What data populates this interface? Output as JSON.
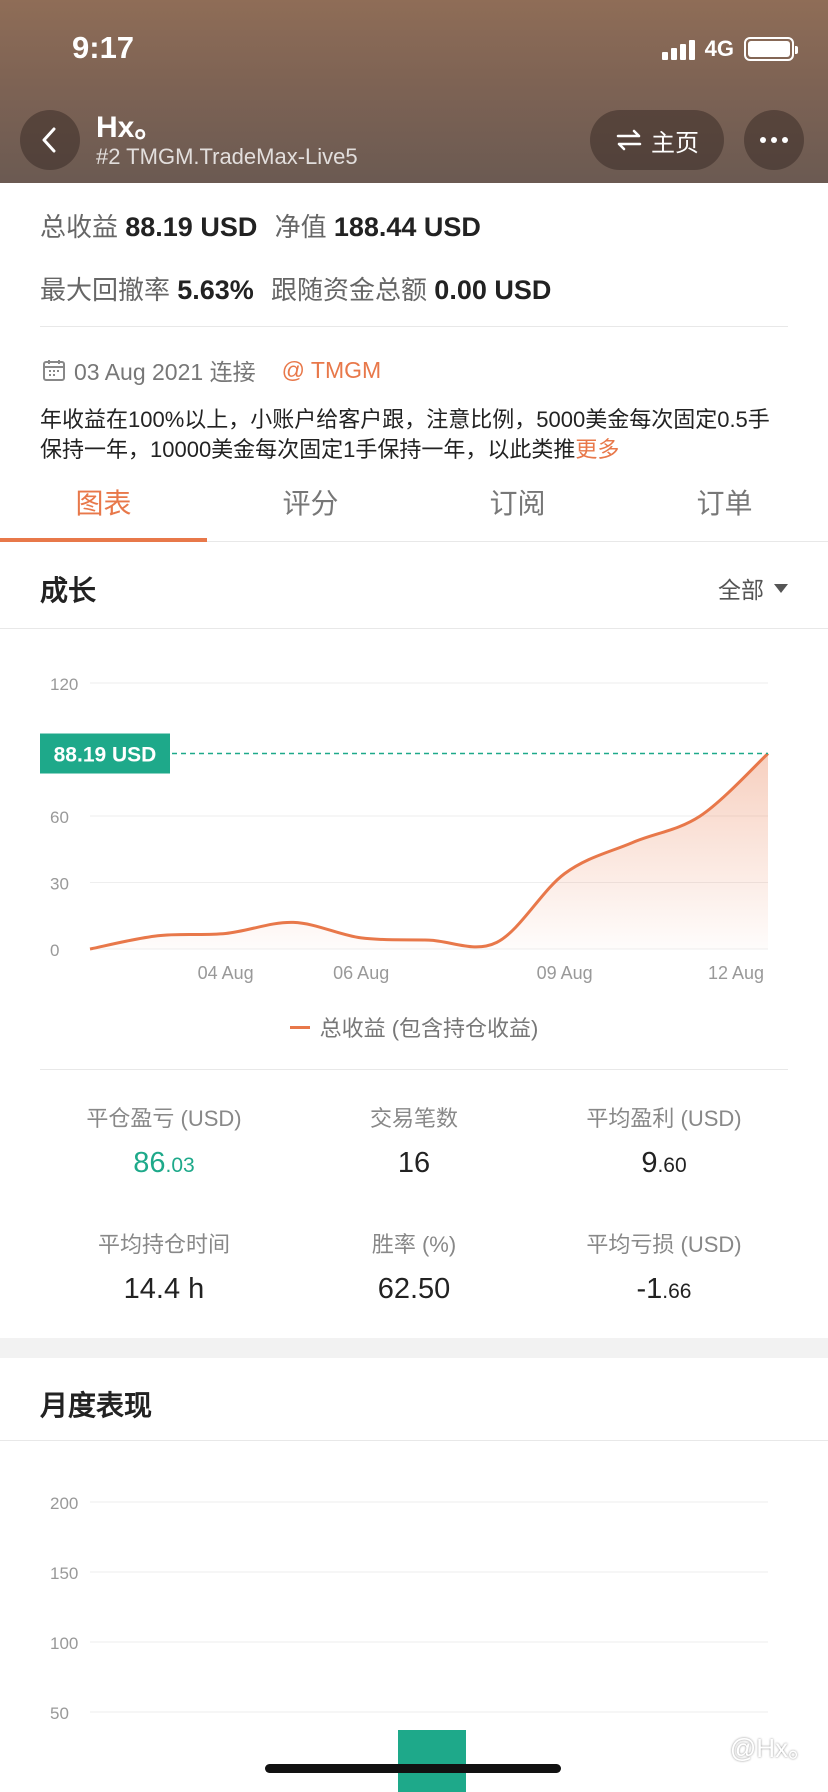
{
  "status_bar": {
    "time": "9:17",
    "network": "4G"
  },
  "header": {
    "title": "Hx。",
    "subtitle": "#2 TMGM.TradeMax-Live5",
    "home_label": "主页"
  },
  "summary": {
    "total_profit_label": "总收益",
    "total_profit_value": "88.19 USD",
    "equity_label": "净值",
    "equity_value": "188.44 USD",
    "max_drawdown_label": "最大回撤率",
    "max_drawdown_value": "5.63%",
    "follow_funds_label": "跟随资金总额",
    "follow_funds_value": "0.00 USD"
  },
  "connect": {
    "date": "03 Aug 2021 连接",
    "broker": "@ TMGM"
  },
  "description": {
    "text": "年收益在100%以上，小账户给客户跟，注意比例，5000美金每次固定0.5手保持一年，10000美金每次固定1手保持一年，以此类推",
    "more": "更多"
  },
  "tabs": [
    "图表",
    "评分",
    "订阅",
    "订单"
  ],
  "growth": {
    "title": "成长",
    "filter": "全部",
    "legend": "总收益 (包含持仓收益)",
    "current_badge": "88.19 USD"
  },
  "stats": [
    {
      "label": "平仓盈亏 (USD)",
      "value_int": "86",
      "value_dec": ".03",
      "color": "#1ea98a"
    },
    {
      "label": "交易笔数",
      "value_int": "16",
      "value_dec": ""
    },
    {
      "label": "平均盈利 (USD)",
      "value_int": "9",
      "value_dec": ".60"
    },
    {
      "label": "平均持仓时间",
      "value_int": "14.4 h",
      "value_dec": ""
    },
    {
      "label": "胜率 (%)",
      "value_int": "62.50",
      "value_dec": ""
    },
    {
      "label": "平均亏损 (USD)",
      "value_int": "-1",
      "value_dec": ".66"
    }
  ],
  "monthly": {
    "title": "月度表现"
  },
  "watermark": "@Hx。",
  "colors": {
    "accent": "#e8784a",
    "green": "#1ea98a"
  },
  "chart_data": [
    {
      "type": "area",
      "title": "",
      "x_ticks": [
        "04 Aug",
        "06 Aug",
        "09 Aug",
        "12 Aug"
      ],
      "y_ticks": [
        0,
        30,
        60,
        120
      ],
      "ylim": [
        0,
        120
      ],
      "series": [
        {
          "name": "总收益 (包含持仓收益)",
          "points": [
            {
              "x": "02 Aug",
              "y": 0
            },
            {
              "x": "03 Aug",
              "y": 6
            },
            {
              "x": "04 Aug",
              "y": 7
            },
            {
              "x": "05 Aug",
              "y": 12
            },
            {
              "x": "06 Aug",
              "y": 5
            },
            {
              "x": "07 Aug",
              "y": 4
            },
            {
              "x": "08 Aug",
              "y": 3
            },
            {
              "x": "09 Aug",
              "y": 34
            },
            {
              "x": "10 Aug",
              "y": 48
            },
            {
              "x": "11 Aug",
              "y": 60
            },
            {
              "x": "12 Aug",
              "y": 88.19
            }
          ]
        }
      ],
      "grid": true
    },
    {
      "type": "bar",
      "y_ticks": [
        50,
        100,
        150,
        200
      ],
      "ylim": [
        0,
        200
      ],
      "grid": true
    }
  ]
}
